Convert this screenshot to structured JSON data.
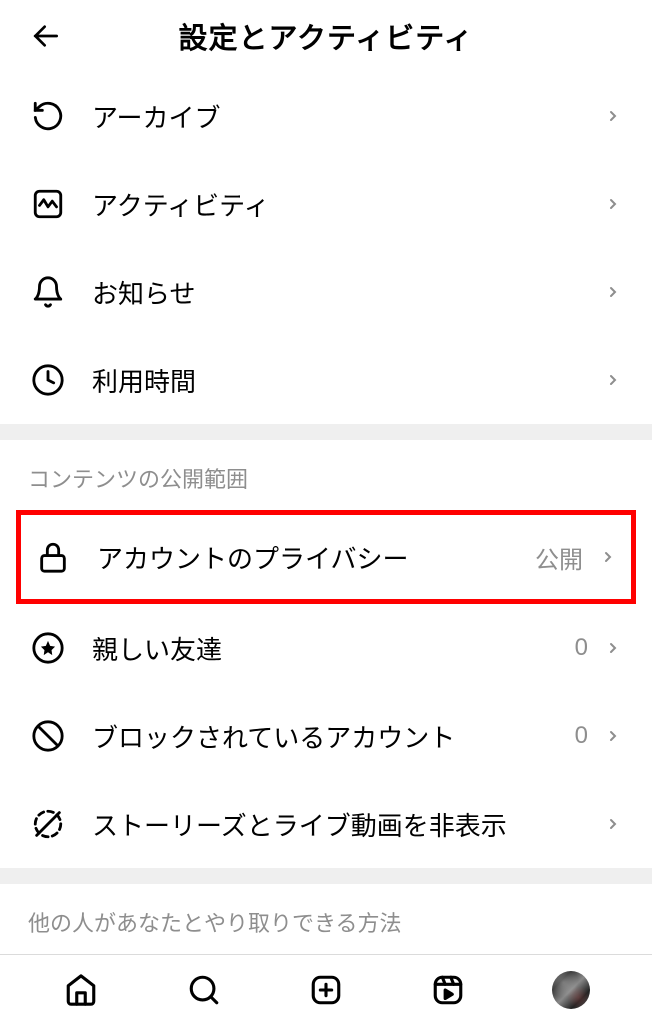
{
  "header": {
    "title": "設定とアクティビティ"
  },
  "section1": {
    "items": [
      {
        "label": "アーカイブ",
        "icon": "archive"
      },
      {
        "label": "アクティビティ",
        "icon": "activity"
      },
      {
        "label": "お知らせ",
        "icon": "bell"
      },
      {
        "label": "利用時間",
        "icon": "clock"
      }
    ]
  },
  "section2": {
    "header": "コンテンツの公開範囲",
    "items": [
      {
        "label": "アカウントのプライバシー",
        "icon": "lock",
        "value": "公開",
        "highlighted": true
      },
      {
        "label": "親しい友達",
        "icon": "star",
        "value": "0"
      },
      {
        "label": "ブロックされているアカウント",
        "icon": "block",
        "value": "0"
      },
      {
        "label": "ストーリーズとライブ動画を非表示",
        "icon": "hide"
      }
    ]
  },
  "section3": {
    "header": "他の人があなたとやり取りできる方法"
  }
}
